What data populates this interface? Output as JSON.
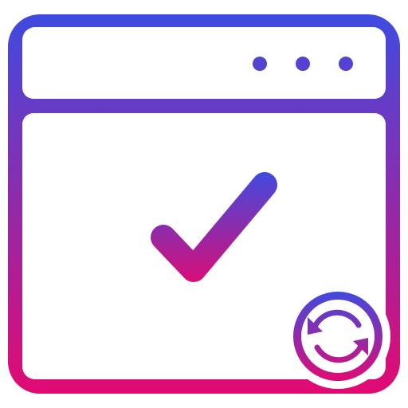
{
  "icon": {
    "name": "browser-window-check-sync",
    "gradient": {
      "top": "#3F4BE0",
      "bottom": "#E20A72"
    },
    "background": "#FFFFFF",
    "window": {
      "dot_count": 3
    },
    "glyphs": [
      "check-icon",
      "sync-icon"
    ]
  }
}
